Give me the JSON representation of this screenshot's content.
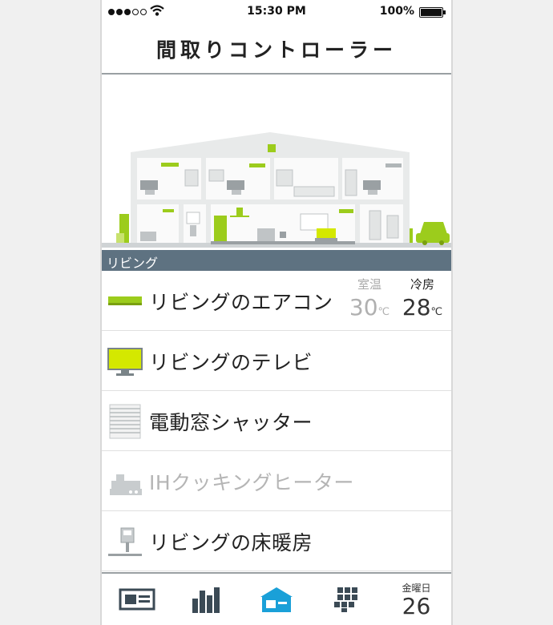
{
  "status_bar": {
    "time": "15:30 PM",
    "battery": "100%"
  },
  "header": {
    "title": "間取りコントローラー"
  },
  "illustration": {
    "selected_room": "リビング"
  },
  "devices": [
    {
      "label": "リビングのエアコン",
      "icon": "air-conditioner-icon",
      "enabled": true,
      "room_temp_label": "室温",
      "room_temp": "30",
      "mode_label": "冷房",
      "set_temp": "28",
      "unit": "℃"
    },
    {
      "label": "リビングのテレビ",
      "icon": "tv-icon",
      "enabled": true
    },
    {
      "label": "電動窓シャッター",
      "icon": "shutter-icon",
      "enabled": true
    },
    {
      "label": "IHクッキングヒーター",
      "icon": "ih-cooker-icon",
      "enabled": false
    },
    {
      "label": "リビングの床暖房",
      "icon": "floor-heating-icon",
      "enabled": true
    }
  ],
  "tabbar": {
    "tabs": [
      {
        "icon": "card-icon"
      },
      {
        "icon": "bar-chart-icon"
      },
      {
        "icon": "house-icon",
        "active": true
      },
      {
        "icon": "keypad-icon"
      }
    ],
    "weekday": "金曜日",
    "day": "26"
  },
  "colors": {
    "accent_green": "#9ccc1c",
    "accent_blue": "#1aa0d8",
    "room_bar": "#5e7281"
  }
}
